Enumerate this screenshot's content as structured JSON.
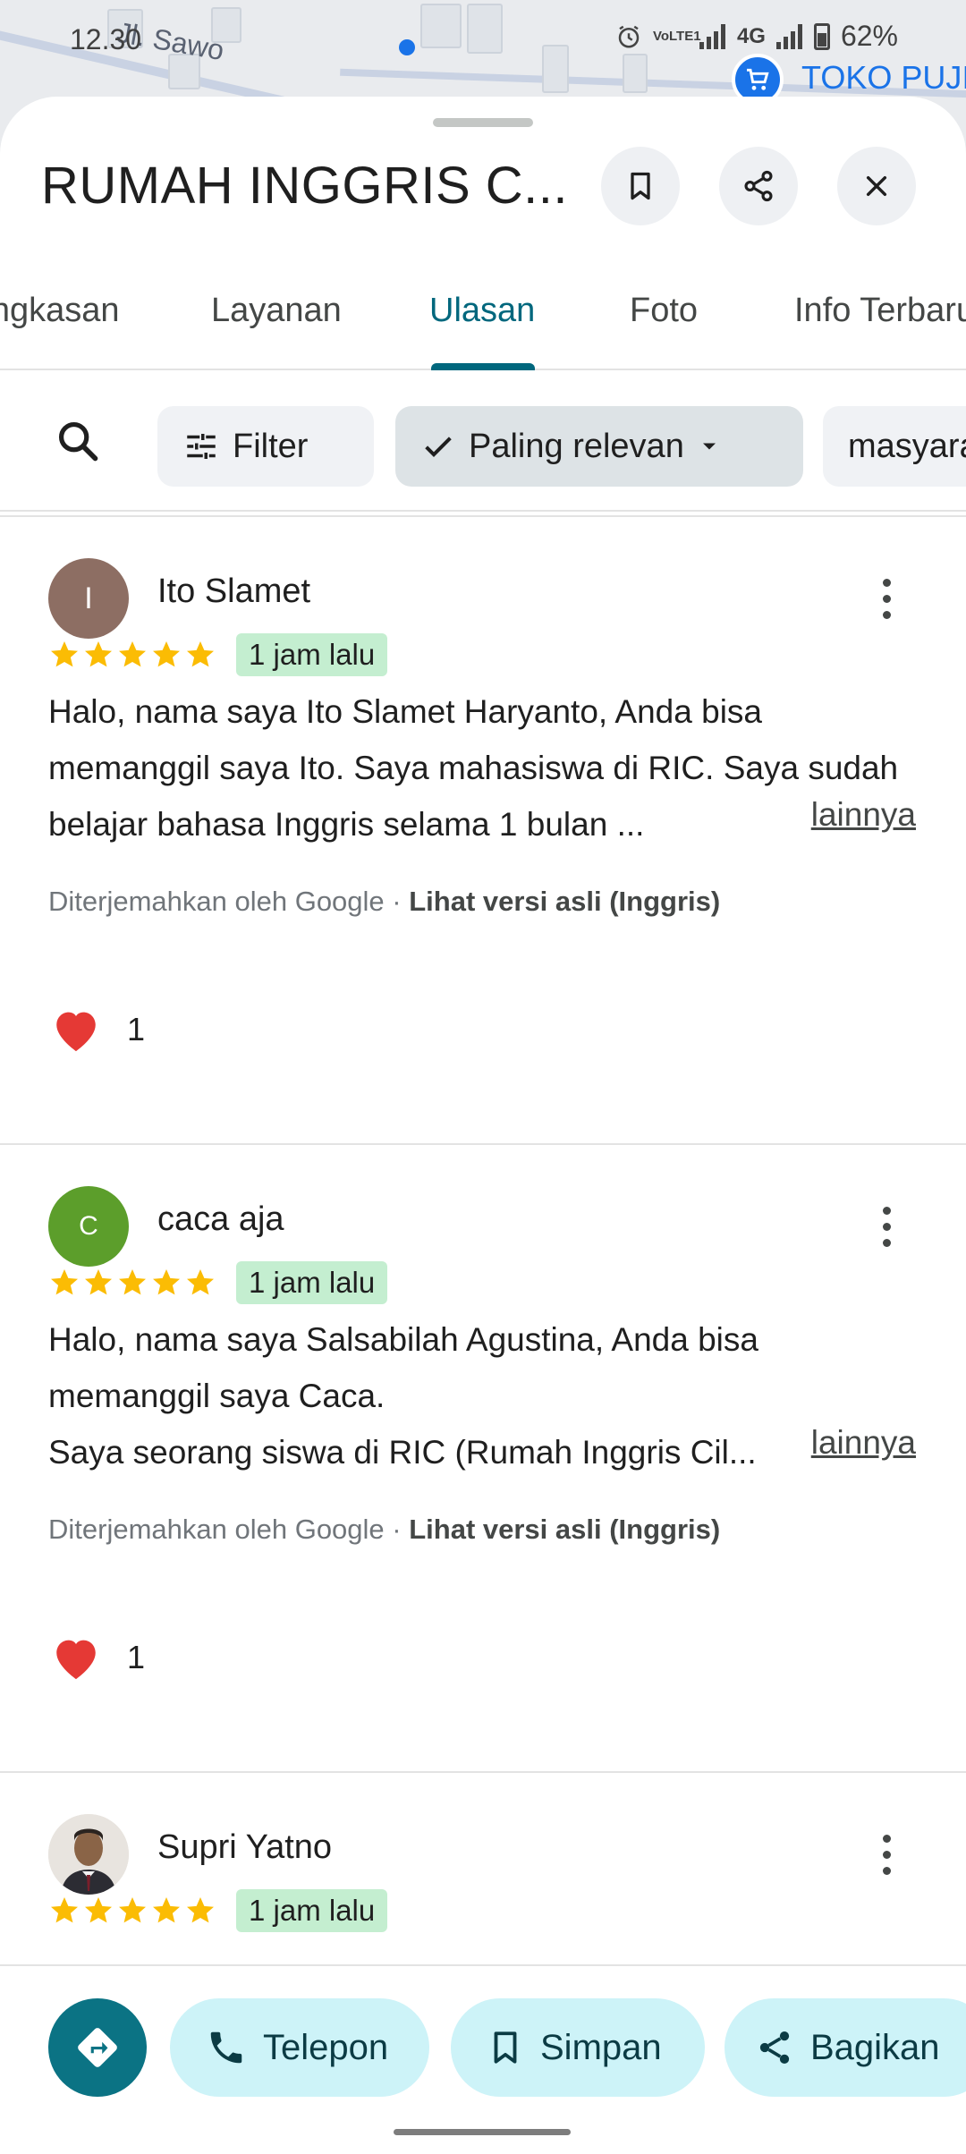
{
  "status_bar": {
    "time": "12.30",
    "battery": "62%",
    "network": "4G",
    "volte": "VoLTE1"
  },
  "map": {
    "street_label": "Jl. Sawo",
    "store_label": "TOKO PUJI"
  },
  "place": {
    "title": "RUMAH INGGRIS C..."
  },
  "tabs": [
    {
      "label": "Ringkasan"
    },
    {
      "label": "Layanan"
    },
    {
      "label": "Ulasan",
      "active": true
    },
    {
      "label": "Foto"
    },
    {
      "label": "Info Terbaru"
    }
  ],
  "filters": {
    "filter_label": "Filter",
    "sort_label": "Paling relevan",
    "topic_label": "masyarakat"
  },
  "reviews": [
    {
      "name": "Ito Slamet",
      "initial": "I",
      "avatar_color": "#8d6e63",
      "rating": 5,
      "time": "1 jam lalu",
      "text": "Halo, nama saya Ito Slamet Haryanto, Anda bisa memanggil saya Ito. Saya mahasiswa di RIC. Saya sudah belajar bahasa Inggris selama 1 bulan ...",
      "more_label": "lainnya",
      "translated_by": "Diterjemahkan oleh Google · ",
      "original_link": "Lihat versi asli (Inggris)",
      "likes": "1"
    },
    {
      "name": "caca aja",
      "initial": "C",
      "avatar_color": "#5c9e2b",
      "rating": 5,
      "time": "1 jam lalu",
      "text": "Halo, nama saya Salsabilah Agustina, Anda bisa memanggil saya Caca.\nSaya seorang siswa di RIC (Rumah Inggris Cil...",
      "more_label": "lainnya",
      "translated_by": "Diterjemahkan oleh Google · ",
      "original_link": "Lihat versi asli (Inggris)",
      "likes": "1"
    },
    {
      "name": "Supri Yatno",
      "rating": 5,
      "time": "1 jam lalu"
    }
  ],
  "actions": {
    "call_label": "Telepon",
    "save_label": "Simpan",
    "share_label": "Bagikan"
  },
  "colors": {
    "accent": "#00677d",
    "star": "#fbbc04",
    "badge_bg": "#c4eed0",
    "action_bg": "#cdf3f8",
    "directions_bg": "#0b7384",
    "heart": "#e53935"
  }
}
